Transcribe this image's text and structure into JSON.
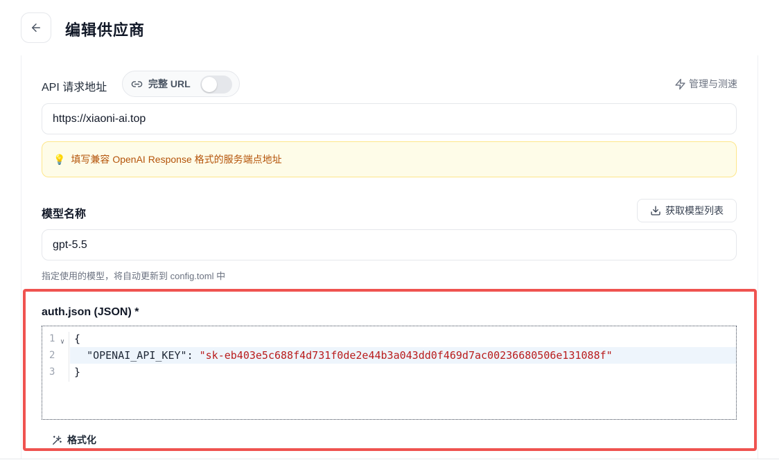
{
  "header": {
    "title": "编辑供应商"
  },
  "api": {
    "label": "API 请求地址",
    "full_url_label": "完整 URL",
    "full_url_enabled": false,
    "manage_label": "管理与测速",
    "url_value": "https://xiaoni-ai.top",
    "hint": "填写兼容 OpenAI Response 格式的服务端点地址"
  },
  "model": {
    "label": "模型名称",
    "fetch_label": "获取模型列表",
    "value": "gpt-5.5",
    "help": "指定使用的模型，将自动更新到 config.toml 中"
  },
  "auth": {
    "label": "auth.json (JSON) *",
    "lines": [
      {
        "num": "1",
        "text": "{"
      },
      {
        "num": "2",
        "key": "\"OPENAI_API_KEY\"",
        "sep": ": ",
        "value": "\"sk-eb403e5c688f4d731f0de2e44b3a043dd0f469d7ac00236680506e131088f\""
      },
      {
        "num": "3",
        "text": "}"
      }
    ],
    "format_label": "格式化"
  },
  "colors": {
    "highlight": "#ef5350",
    "hint_bg": "#fefce8",
    "hint_text": "#b45309"
  },
  "icons": {
    "back": "arrow-left-icon",
    "link": "link-icon",
    "zap": "zap-icon",
    "bulb": "lightbulb-icon",
    "download": "download-icon",
    "wand": "magic-wand-icon"
  }
}
